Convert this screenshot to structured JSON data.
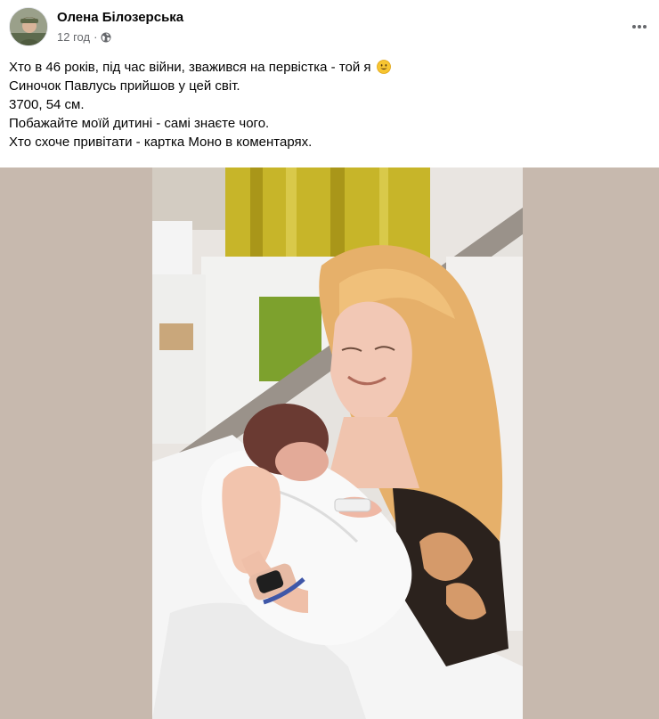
{
  "post": {
    "author": "Олена Білозерська",
    "time": "12 год",
    "separator": "·",
    "audience_icon": "globe-icon",
    "more_icon": "more-horizontal-icon",
    "lines": [
      "Хто в 46 років, під час війни, зважився на первістка - той я",
      "Синочок Павлусь прийшов у цей світ.",
      "3700, 54 см.",
      "Побажайте моїй дитині - самі знаєте чого.",
      "Хто схоче привітати - картка Моно в коментарях."
    ],
    "emoji": "smiling-face-icon"
  },
  "colors": {
    "text": "#050505",
    "secondary_text": "#65676b",
    "media_background": "#c7b9ae"
  }
}
